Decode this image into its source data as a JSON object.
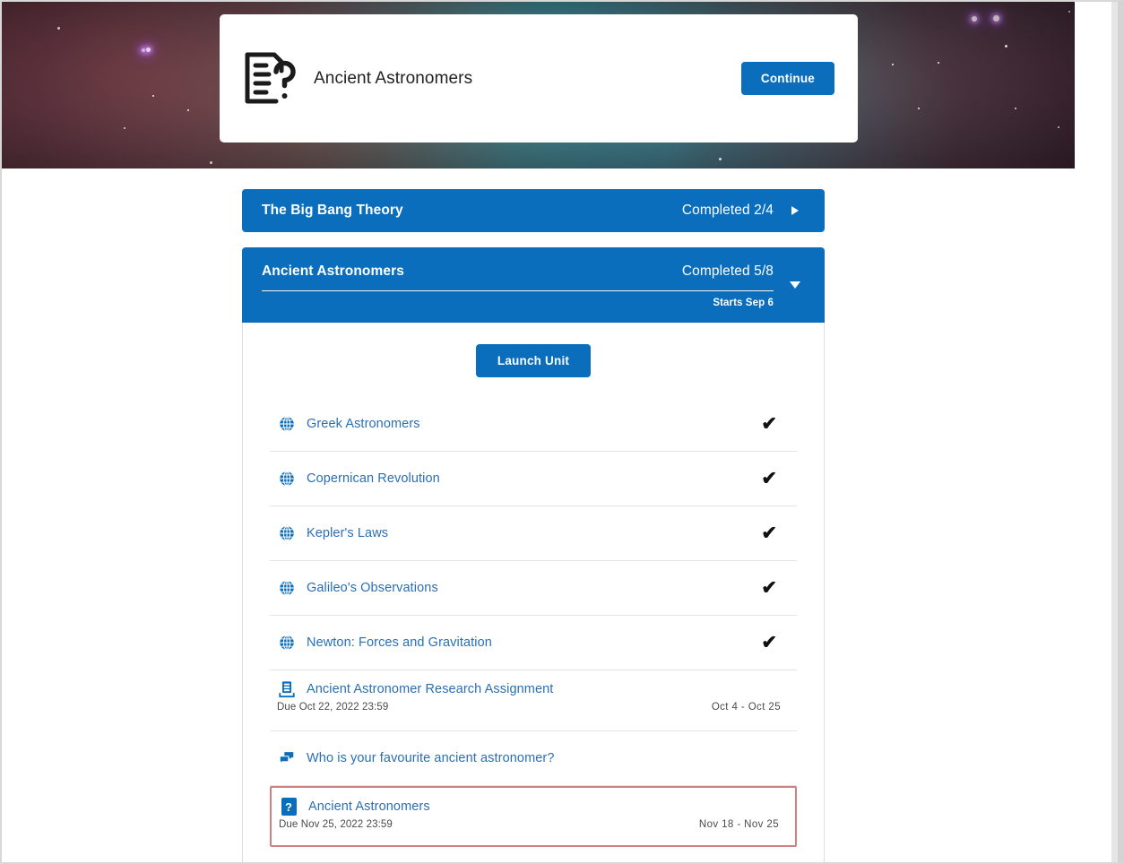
{
  "hero": {
    "icon": "quiz-document-icon",
    "title": "Ancient Astronomers",
    "continue_label": "Continue",
    "accent_color": "#0a6ebd"
  },
  "modules": [
    {
      "title": "The Big Bang Theory",
      "status": "Completed 2/4",
      "expanded": false,
      "toggle_icon": "triangle-right-icon"
    },
    {
      "title": "Ancient Astronomers",
      "status": "Completed 5/8",
      "starts": "Starts Sep 6",
      "expanded": true,
      "toggle_icon": "triangle-down-icon",
      "launch_label": "Launch Unit",
      "items": [
        {
          "icon": "globe-icon",
          "title": "Greek Astronomers",
          "completed": true,
          "check": "✔"
        },
        {
          "icon": "globe-icon",
          "title": "Copernican Revolution",
          "completed": true,
          "check": "✔"
        },
        {
          "icon": "globe-icon",
          "title": "Kepler's Laws",
          "completed": true,
          "check": "✔"
        },
        {
          "icon": "globe-icon",
          "title": "Galileo's Observations",
          "completed": true,
          "check": "✔"
        },
        {
          "icon": "globe-icon",
          "title": "Newton: Forces and Gravitation",
          "completed": true,
          "check": "✔"
        },
        {
          "icon": "assignment-icon",
          "title": "Ancient Astronomer Research Assignment",
          "due": "Due Oct 22, 2022 23:59",
          "range": "Oct 4 - Oct 25",
          "completed": false
        },
        {
          "icon": "discussion-icon",
          "title": "Who is your favourite ancient astronomer?",
          "completed": false
        },
        {
          "icon": "quiz-icon",
          "icon_glyph": "?",
          "title": "Ancient Astronomers",
          "due": "Due Nov 25, 2022 23:59",
          "range": "Nov 18 - Nov 25",
          "highlighted": true,
          "highlight_color": "#cf8181",
          "completed": false
        }
      ]
    }
  ]
}
